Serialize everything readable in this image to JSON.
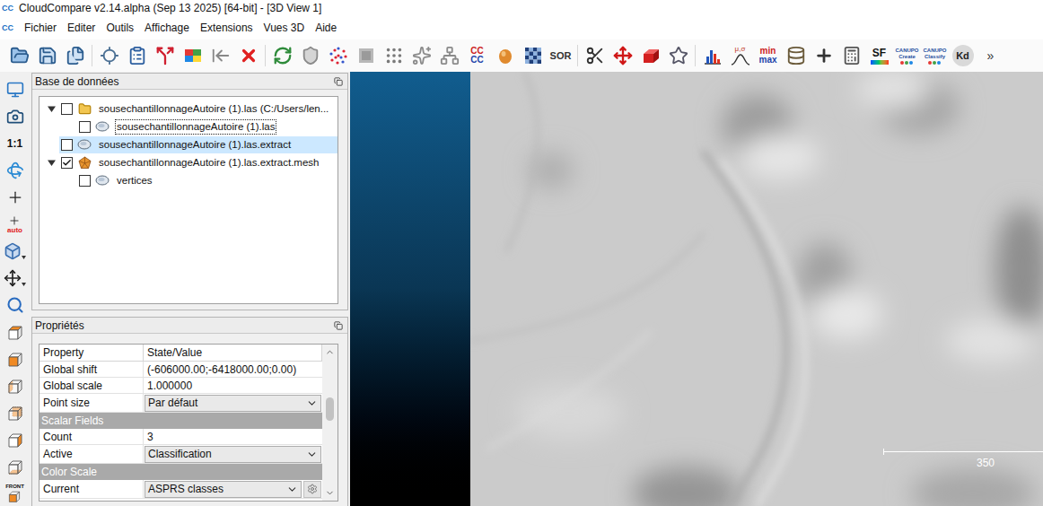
{
  "window": {
    "title": "CloudCompare v2.14.alpha (Sep 13 2025) [64-bit] - [3D View 1]",
    "logo": "CC"
  },
  "menu_bar": {
    "logo": "CC",
    "items": [
      "Fichier",
      "Editer",
      "Outils",
      "Affichage",
      "Extensions",
      "Vues 3D",
      "Aide"
    ]
  },
  "toolbar": [
    {
      "kind": "open"
    },
    {
      "kind": "save"
    },
    {
      "kind": "save-all"
    },
    {
      "kind": "separator"
    },
    {
      "kind": "sensor"
    },
    {
      "kind": "properties"
    },
    {
      "kind": "clone"
    },
    {
      "kind": "colors"
    },
    {
      "kind": "merge"
    },
    {
      "kind": "delete"
    },
    {
      "kind": "separator"
    },
    {
      "kind": "register"
    },
    {
      "kind": "normals"
    },
    {
      "kind": "sample"
    },
    {
      "kind": "rasterize"
    },
    {
      "kind": "subsample"
    },
    {
      "kind": "noise"
    },
    {
      "kind": "delaunay"
    },
    {
      "kind": "stack",
      "lines": [
        "CC",
        "CC"
      ]
    },
    {
      "kind": "blob"
    },
    {
      "kind": "checker"
    },
    {
      "kind": "text",
      "label": "SOR"
    },
    {
      "kind": "separator"
    },
    {
      "kind": "segment"
    },
    {
      "kind": "translate"
    },
    {
      "kind": "box"
    },
    {
      "kind": "pick"
    },
    {
      "kind": "separator"
    },
    {
      "kind": "histogram"
    },
    {
      "kind": "stat",
      "label": "μ,σ"
    },
    {
      "kind": "stack",
      "lines": [
        "min",
        "max"
      ]
    },
    {
      "kind": "filter"
    },
    {
      "kind": "plus"
    },
    {
      "kind": "calculator"
    },
    {
      "kind": "sf",
      "label": "SF"
    },
    {
      "kind": "plugin",
      "lines": [
        "CANUPO",
        "Create"
      ]
    },
    {
      "kind": "plugin",
      "lines": [
        "CANUPO",
        "Classify"
      ]
    },
    {
      "kind": "kd",
      "label": "Kd"
    },
    {
      "kind": "more",
      "label": "»"
    }
  ],
  "side_toolbar": [
    {
      "kind": "display"
    },
    {
      "kind": "camera"
    },
    {
      "kind": "text",
      "label": "1:1"
    },
    {
      "kind": "orbit"
    },
    {
      "kind": "pivot"
    },
    {
      "kind": "pivot-auto",
      "label": "auto"
    },
    {
      "kind": "projection"
    },
    {
      "kind": "interaction"
    },
    {
      "kind": "zoom"
    },
    {
      "kind": "view-top"
    },
    {
      "kind": "view-front"
    },
    {
      "kind": "view-left"
    },
    {
      "kind": "view-back"
    },
    {
      "kind": "view-right"
    },
    {
      "kind": "view-bottom"
    },
    {
      "kind": "view-iso",
      "label": "FRONT"
    }
  ],
  "db_panel": {
    "title": "Base de données",
    "tree": [
      {
        "label": "sousechantillonnageAutoire (1).las (C:/Users/len...",
        "kind": "folder",
        "checked": false,
        "selected": false,
        "focused": false,
        "expanded": true,
        "children": [
          {
            "label": "sousechantillonnageAutoire (1).las",
            "kind": "cloud",
            "checked": false,
            "selected": false,
            "focused": true,
            "children": []
          }
        ]
      },
      {
        "label": "sousechantillonnageAutoire (1).las.extract",
        "kind": "cloud",
        "checked": false,
        "selected": true,
        "focused": false,
        "children": []
      },
      {
        "label": "sousechantillonnageAutoire (1).las.extract.mesh",
        "kind": "mesh",
        "checked": true,
        "selected": false,
        "focused": false,
        "expanded": true,
        "children": [
          {
            "label": "vertices",
            "kind": "cloud",
            "checked": false,
            "selected": false,
            "focused": false,
            "children": []
          }
        ]
      }
    ]
  },
  "properties_panel": {
    "title": "Propriétés",
    "columns": [
      "Property",
      "State/Value"
    ],
    "scroll_level": 0.3,
    "rows": [
      {
        "kind": "text",
        "property": "Global shift",
        "value": "(-606000.00;-6418000.00;0.00)"
      },
      {
        "kind": "text",
        "property": "Global scale",
        "value": "1.000000"
      },
      {
        "kind": "select",
        "property": "Point size",
        "value": "Par défaut"
      },
      {
        "kind": "section",
        "label": "Scalar Fields"
      },
      {
        "kind": "text",
        "property": "Count",
        "value": "3"
      },
      {
        "kind": "select",
        "property": "Active",
        "value": "Classification"
      },
      {
        "kind": "section",
        "label": "Color Scale"
      },
      {
        "kind": "select-gear",
        "property": "Current",
        "value": "ASPRS classes"
      }
    ]
  },
  "view": {
    "scale_bar": {
      "label": "350"
    }
  }
}
